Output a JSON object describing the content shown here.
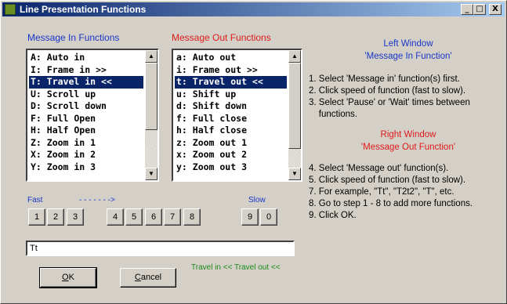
{
  "window": {
    "title": "Line Presentation Functions",
    "controls": {
      "minimize": "_",
      "maximize": "□",
      "close": "X"
    }
  },
  "message_in": {
    "heading": "Message In Functions",
    "items": [
      "A: Auto in",
      "I: Frame in >>",
      "T: Travel in <<",
      "U: Scroll up",
      "D: Scroll down",
      "F: Full Open",
      "H: Half Open",
      "Z: Zoom in 1",
      "X: Zoom in 2",
      "Y: Zoom in 3"
    ],
    "selected_index": 2
  },
  "message_out": {
    "heading": "Message Out Functions",
    "items": [
      "a: Auto out",
      "i: Frame out >>",
      "t: Travel out <<",
      "u: Shift up",
      "d: Shift down",
      "f: Full close",
      "h: Half close",
      "z: Zoom out 1",
      "x: Zoom out 2",
      "y: Zoom out 3"
    ],
    "selected_index": 2
  },
  "speed": {
    "fast_label": "Fast",
    "arrow_label": "- - - - - - ->",
    "slow_label": "Slow",
    "buttons": [
      "1",
      "2",
      "3",
      "4",
      "5",
      "6",
      "7",
      "8",
      "9",
      "0"
    ]
  },
  "sequence_input": {
    "value": "Tt"
  },
  "preview_text": "Travel in <<  Travel out <<",
  "buttons": {
    "ok": {
      "mnemonic": "O",
      "rest": "K"
    },
    "cancel": {
      "mnemonic": "C",
      "rest": "ancel"
    }
  },
  "instructions": {
    "left_title": [
      "Left Window",
      "'Message In Function'"
    ],
    "left_steps": [
      "1. Select 'Message in' function(s) first.",
      "2. Click speed of function (fast to slow).",
      "3. Select 'Pause' or 'Wait' times between",
      "    functions."
    ],
    "right_title": [
      "Right Window",
      "'Message Out Function'"
    ],
    "right_steps": [
      "4. Select 'Message out' function(s).",
      "5. Click speed of function (fast to slow).",
      "7. For example, \"Tt\", \"T2t2\", \"T\", etc.",
      "8. Go to step 1 - 8 to add more functions.",
      "9. Click OK."
    ]
  },
  "colors": {
    "title_bar": "#0a246a",
    "heading_in": "#1a36c8",
    "heading_out": "#e01a1a",
    "preview": "#1a8a1a",
    "selection": "#0a246a"
  }
}
